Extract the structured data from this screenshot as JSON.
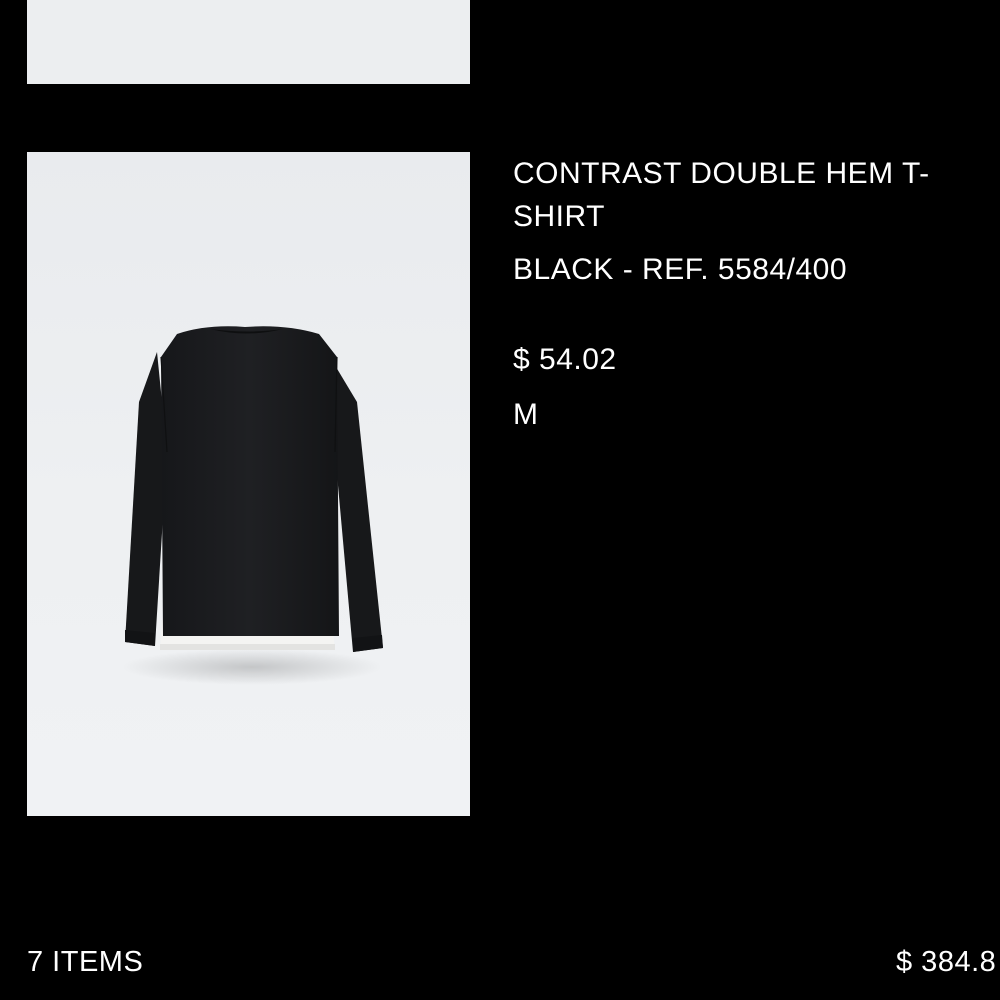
{
  "cart": {
    "items": [
      {
        "name": "CONTRAST DOUBLE HEM T-SHIRT",
        "color_ref": "BLACK - REF. 5584/400",
        "price": "$ 54.02",
        "size": "M",
        "image_icon": "tshirt-back-image"
      }
    ],
    "summary": {
      "count_label": "7 ITEMS",
      "total": "$ 384.8"
    }
  },
  "colors": {
    "background": "#000000",
    "thumbnail_bg": "#eceef0",
    "shirt": "#1a1b1d",
    "hem": "#f4f4f2"
  }
}
